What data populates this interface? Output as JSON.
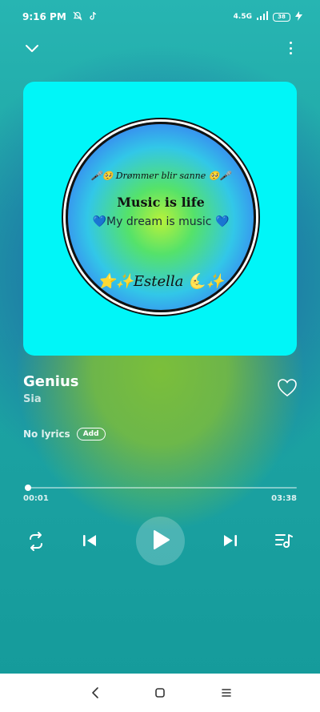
{
  "status_bar": {
    "time": "9:16 PM",
    "left_icons": [
      "bell-off-icon",
      "tiktok-icon"
    ],
    "network": "4.5G",
    "battery_level": "38",
    "right_icons": [
      "signal-icon",
      "battery-icon",
      "charging-icon"
    ]
  },
  "top_bar": {
    "icons": [
      "chevron-down-icon",
      "more-vertical-icon"
    ]
  },
  "album_art": {
    "background_color": "#00f6f8",
    "line1": "🎤🥺 Drømmer blir sanne 🥺🎤",
    "line2": "Music is life",
    "line3": "💙My dream is music 💙",
    "line4": "⭐✨Estella 🌜✨"
  },
  "track": {
    "title": "Genius",
    "artist": "Sia",
    "favorite_icon": "heart-outline-icon"
  },
  "lyrics": {
    "status": "No lyrics",
    "add_label": "Add"
  },
  "playback": {
    "current_time": "00:01",
    "total_time": "03:38",
    "progress_fraction": 0.005
  },
  "controls": {
    "icons": [
      "repeat-icon",
      "previous-icon",
      "play-icon",
      "next-icon",
      "queue-icon"
    ]
  },
  "nav_bar": {
    "icons": [
      "back-icon",
      "home-icon",
      "recents-icon"
    ]
  }
}
